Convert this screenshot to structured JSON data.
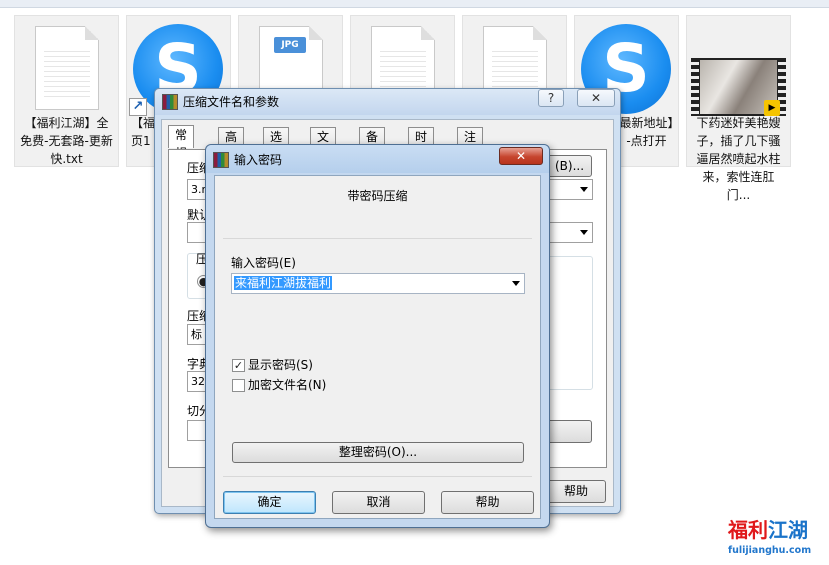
{
  "explorer": {
    "files": [
      {
        "caption": "【福利江湖】全免费-无套路-更新快.txt",
        "icon": "text-document-icon"
      },
      {
        "caption": "【福利江湖】网页1",
        "icon": "sogou-browser-shortcut-icon"
      },
      {
        "caption": "",
        "icon": "jpg-image-icon",
        "badge": "JPG"
      },
      {
        "caption": "",
        "icon": "text-document-icon"
      },
      {
        "caption": "",
        "icon": "text-document-icon"
      },
      {
        "caption": "最新地址】-点打开",
        "icon": "sogou-browser-icon"
      },
      {
        "caption": "下药迷奸美艳嫂子，插了几下骚逼居然喷起水柱来，索性连肛门...",
        "icon": "video-file-icon",
        "badge": "Player"
      }
    ]
  },
  "compress_dialog": {
    "title": "压缩文件名和参数",
    "help_button": "?",
    "close_button": "✕",
    "tabs": [
      "常规",
      "高级",
      "选项",
      "文件",
      "备份",
      "时间",
      "注释"
    ],
    "archive_name_label": "压缩",
    "archive_name_value": "3.r",
    "browse_button": "(B)...",
    "default_profile_label": "默认",
    "format_label": "压",
    "method_label": "压缩",
    "method_value": "标",
    "dict_label": "字典",
    "dict_value": "32",
    "split_label": "切分",
    "help_bottom_button": "帮助"
  },
  "password_dialog": {
    "title": "输入密码",
    "close_button": "✕",
    "heading": "带密码压缩",
    "password_label": "输入密码(E)",
    "password_value": "来福利江湖拔福利",
    "show_password_label": "显示密码(S)",
    "show_password_checked": true,
    "encrypt_names_label": "加密文件名(N)",
    "encrypt_names_checked": false,
    "organize_button": "整理密码(O)...",
    "ok_button": "确定",
    "cancel_button": "取消",
    "help_button": "帮助"
  },
  "watermark": {
    "brand": "福利江湖",
    "url": "fulijianghu.com",
    "colors": {
      "red": "#e0191b",
      "blue": "#1a73c9"
    }
  }
}
